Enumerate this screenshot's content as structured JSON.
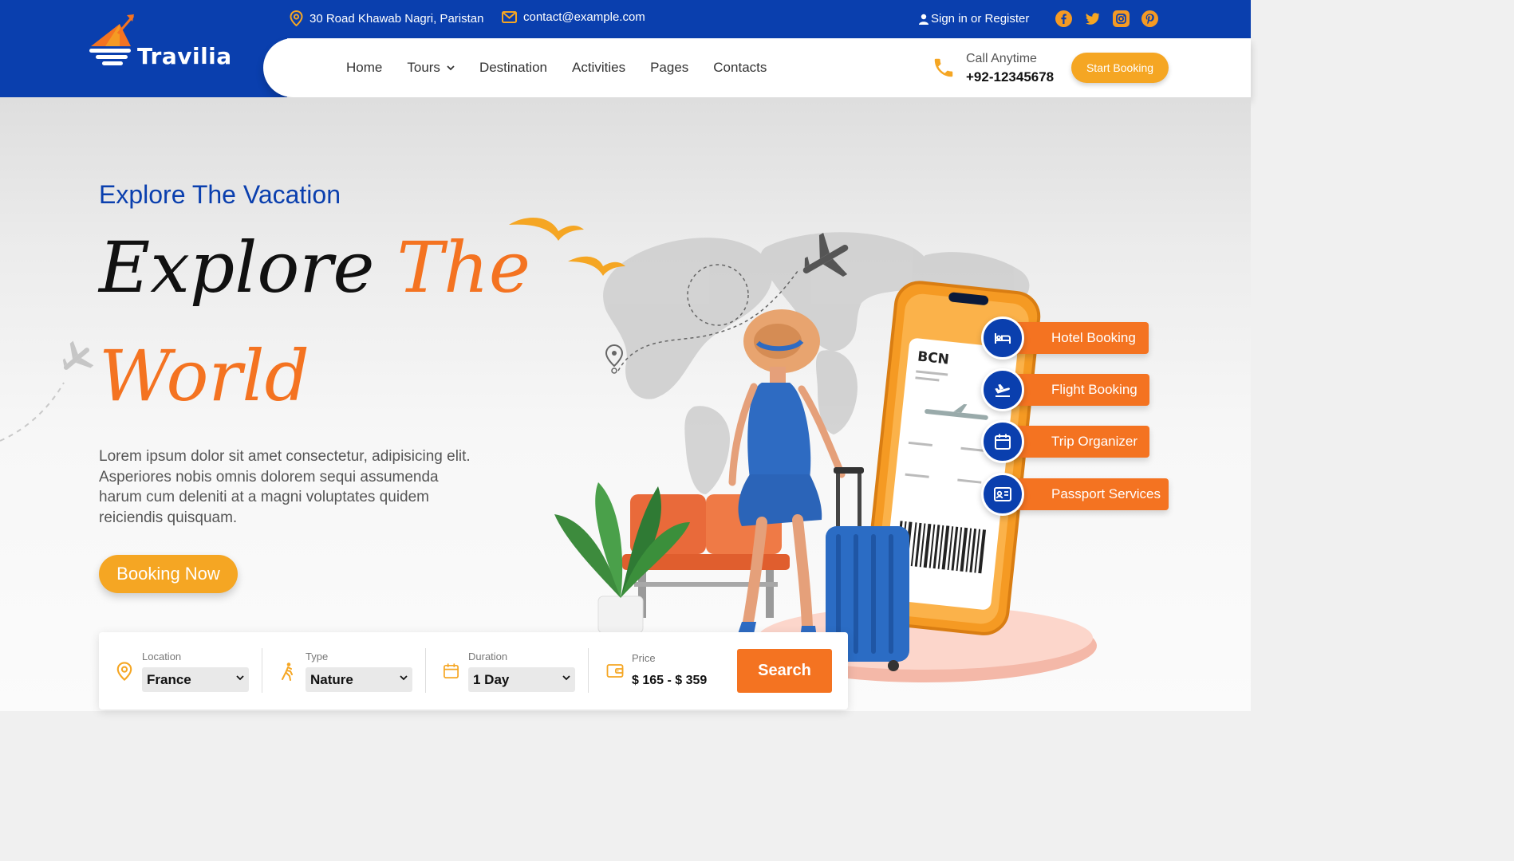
{
  "brand": {
    "name": "Travilia"
  },
  "topbar": {
    "address": "30 Road Khawab Nagri, Paristan",
    "email": "contact@example.com",
    "signin": "Sign in or Register",
    "socials": [
      "facebook-icon",
      "twitter-icon",
      "instagram-icon",
      "pinterest-icon"
    ]
  },
  "nav": {
    "items": [
      {
        "label": "Home"
      },
      {
        "label": "Tours",
        "has_dropdown": true
      },
      {
        "label": "Destination"
      },
      {
        "label": "Activities"
      },
      {
        "label": "Pages"
      },
      {
        "label": "Contacts"
      }
    ]
  },
  "contact": {
    "label": "Call Anytime",
    "phone": "+92-12345678"
  },
  "cta": {
    "start_booking": "Start Booking"
  },
  "hero": {
    "kicker": "Explore The Vacation",
    "headline_part1": "Explore",
    "headline_part2": "The",
    "headline_part3": "World",
    "description": "Lorem ipsum dolor sit amet consectetur, adipisicing elit. Asperiores nobis omnis dolorem sequi assumenda harum cum deleniti at a magni voluptates quidem reiciendis quisquam.",
    "booking_button": "Booking Now"
  },
  "illustration": {
    "ticket_code": "BCN"
  },
  "services": [
    {
      "label": "Hotel Booking",
      "icon": "bed-icon"
    },
    {
      "label": "Flight Booking",
      "icon": "plane-icon"
    },
    {
      "label": "Trip Organizer",
      "icon": "calendar-icon"
    },
    {
      "label": "Passport Services",
      "icon": "id-card-icon"
    }
  ],
  "search": {
    "location": {
      "label": "Location",
      "value": "France"
    },
    "type": {
      "label": "Type",
      "value": "Nature"
    },
    "duration": {
      "label": "Duration",
      "value": "1 Day"
    },
    "price": {
      "label": "Price",
      "value": "$ 165 - $ 359"
    },
    "button": "Search"
  },
  "colors": {
    "brand_blue": "#0a3fae",
    "accent_orange": "#f47321",
    "accent_yellow": "#f5a623"
  }
}
